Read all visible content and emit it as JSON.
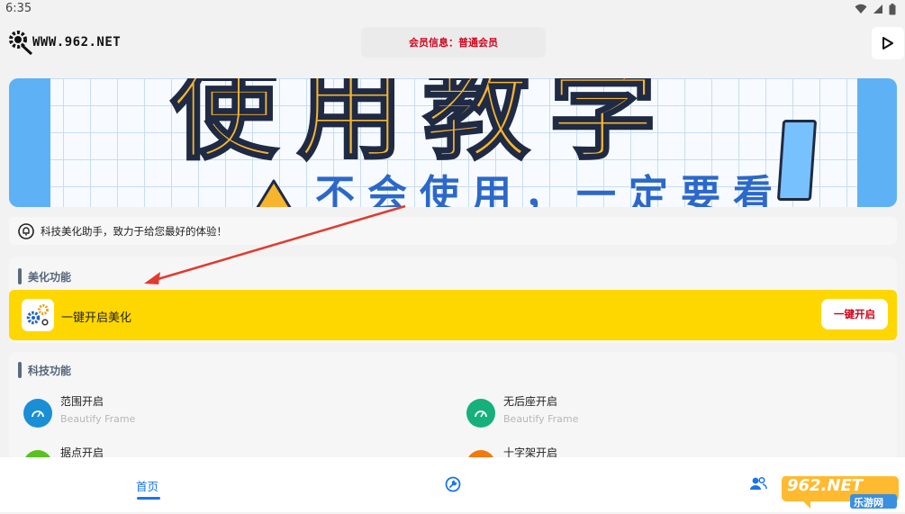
{
  "status_bar": {
    "time": "6:35"
  },
  "header": {
    "logo_text": "WWW.962.NET",
    "member_info": "会员信息：普通会员"
  },
  "banner": {
    "title": "使用教学",
    "subtitle": "不会使用，一定要看"
  },
  "notice": {
    "text": "科技美化助手，致力于给您最好的体验！"
  },
  "beautify_section": {
    "title": "美化功能",
    "item_label": "一键开启美化",
    "button_label": "一键开启",
    "accent_color": "#ffd700"
  },
  "tech_section": {
    "title": "科技功能",
    "features": [
      {
        "name": "范围开启",
        "subtitle": "Beautify Frame",
        "color": "#1a8fd6",
        "icon": "speedometer-icon"
      },
      {
        "name": "无后座开启",
        "subtitle": "Beautify Frame",
        "color": "#16b07c",
        "icon": "speedometer-icon"
      },
      {
        "name": "据点开启",
        "subtitle": "",
        "color": "#5ac21e",
        "icon": "target-icon"
      },
      {
        "name": "十字架开启",
        "subtitle": "",
        "color": "#f07a10",
        "icon": "crosshair-icon"
      }
    ]
  },
  "bottom_nav": {
    "home_label": "首页",
    "active_color": "#1a74e8"
  },
  "watermark": {
    "text": "962.NET",
    "subtext": "乐游网"
  }
}
